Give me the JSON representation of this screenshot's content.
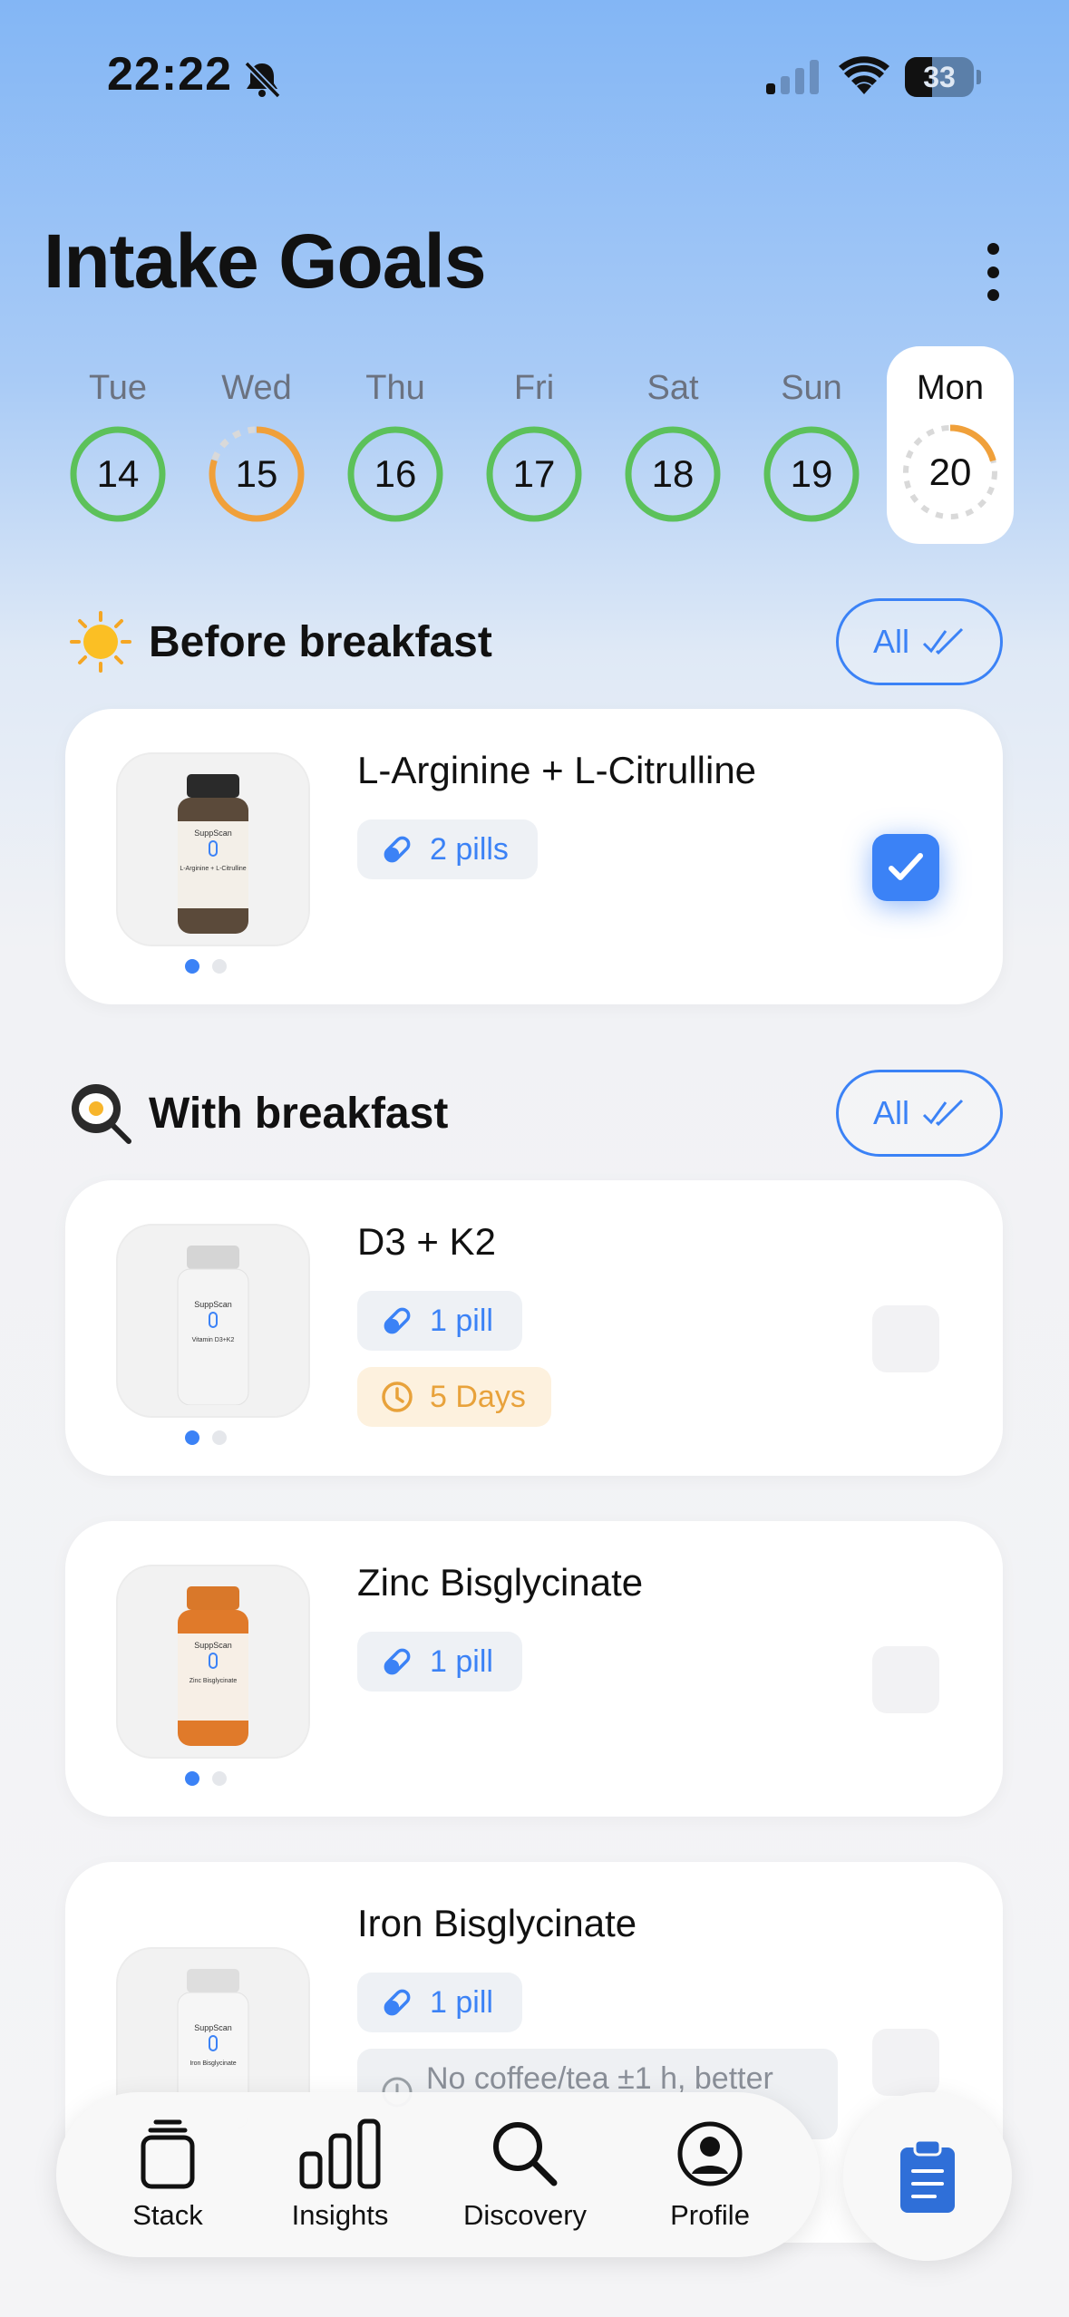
{
  "status_bar": {
    "time": "22:22",
    "battery": "33"
  },
  "header": {
    "title": "Intake Goals"
  },
  "days": [
    {
      "name": "Tue",
      "num": "14",
      "progress": 1.0,
      "status": "complete"
    },
    {
      "name": "Wed",
      "num": "15",
      "progress": 0.8,
      "status": "partial"
    },
    {
      "name": "Thu",
      "num": "16",
      "progress": 1.0,
      "status": "complete"
    },
    {
      "name": "Fri",
      "num": "17",
      "progress": 1.0,
      "status": "complete"
    },
    {
      "name": "Sat",
      "num": "18",
      "progress": 1.0,
      "status": "complete"
    },
    {
      "name": "Sun",
      "num": "19",
      "progress": 1.0,
      "status": "complete"
    },
    {
      "name": "Mon",
      "num": "20",
      "progress": 0.2,
      "status": "selected"
    }
  ],
  "colors": {
    "accent": "#3b82f6",
    "complete": "#5cc15a",
    "partial": "#f0a03a",
    "empty": "#d6d6d6"
  },
  "sections": [
    {
      "label": "Before breakfast",
      "icon": "sun-icon",
      "all_label": "All"
    },
    {
      "label": "With breakfast",
      "icon": "frying-pan-egg-icon",
      "all_label": "All"
    }
  ],
  "supplements": [
    {
      "name": "L-Arginine + L-Citrulline",
      "dose": "2 pills",
      "checked": true,
      "brand": "SuppScan",
      "label": "L-Arginine + L-Citrulline",
      "cap_color": "#2a2a2a",
      "body_color": "#5b4a3a"
    },
    {
      "name": "D3 + K2",
      "dose": "1 pill",
      "duration": "5 Days",
      "checked": false,
      "brand": "SuppScan",
      "label": "Vitamin D3+K2",
      "cap_color": "#d8d8d8",
      "body_color": "#f4f4f4"
    },
    {
      "name": "Zinc Bisglycinate",
      "dose": "1 pill",
      "checked": false,
      "brand": "SuppScan",
      "label": "Zinc Bisglycinate",
      "cap_color": "#d9782a",
      "body_color": "#e07a2a"
    },
    {
      "name": "Iron Bisglycinate",
      "dose": "1 pill",
      "note": "No coffee/tea ±1 h, better",
      "checked": false,
      "brand": "SuppScan",
      "label": "Iron Bisglycinate",
      "cap_color": "#e0e0e0",
      "body_color": "#f6f6f6"
    }
  ],
  "tabbar": {
    "items": [
      {
        "label": "Stack",
        "icon": "stack-icon"
      },
      {
        "label": "Insights",
        "icon": "bar-chart-icon"
      },
      {
        "label": "Discovery",
        "icon": "search-icon"
      },
      {
        "label": "Profile",
        "icon": "profile-icon"
      }
    ],
    "fab_icon": "clipboard-icon"
  }
}
